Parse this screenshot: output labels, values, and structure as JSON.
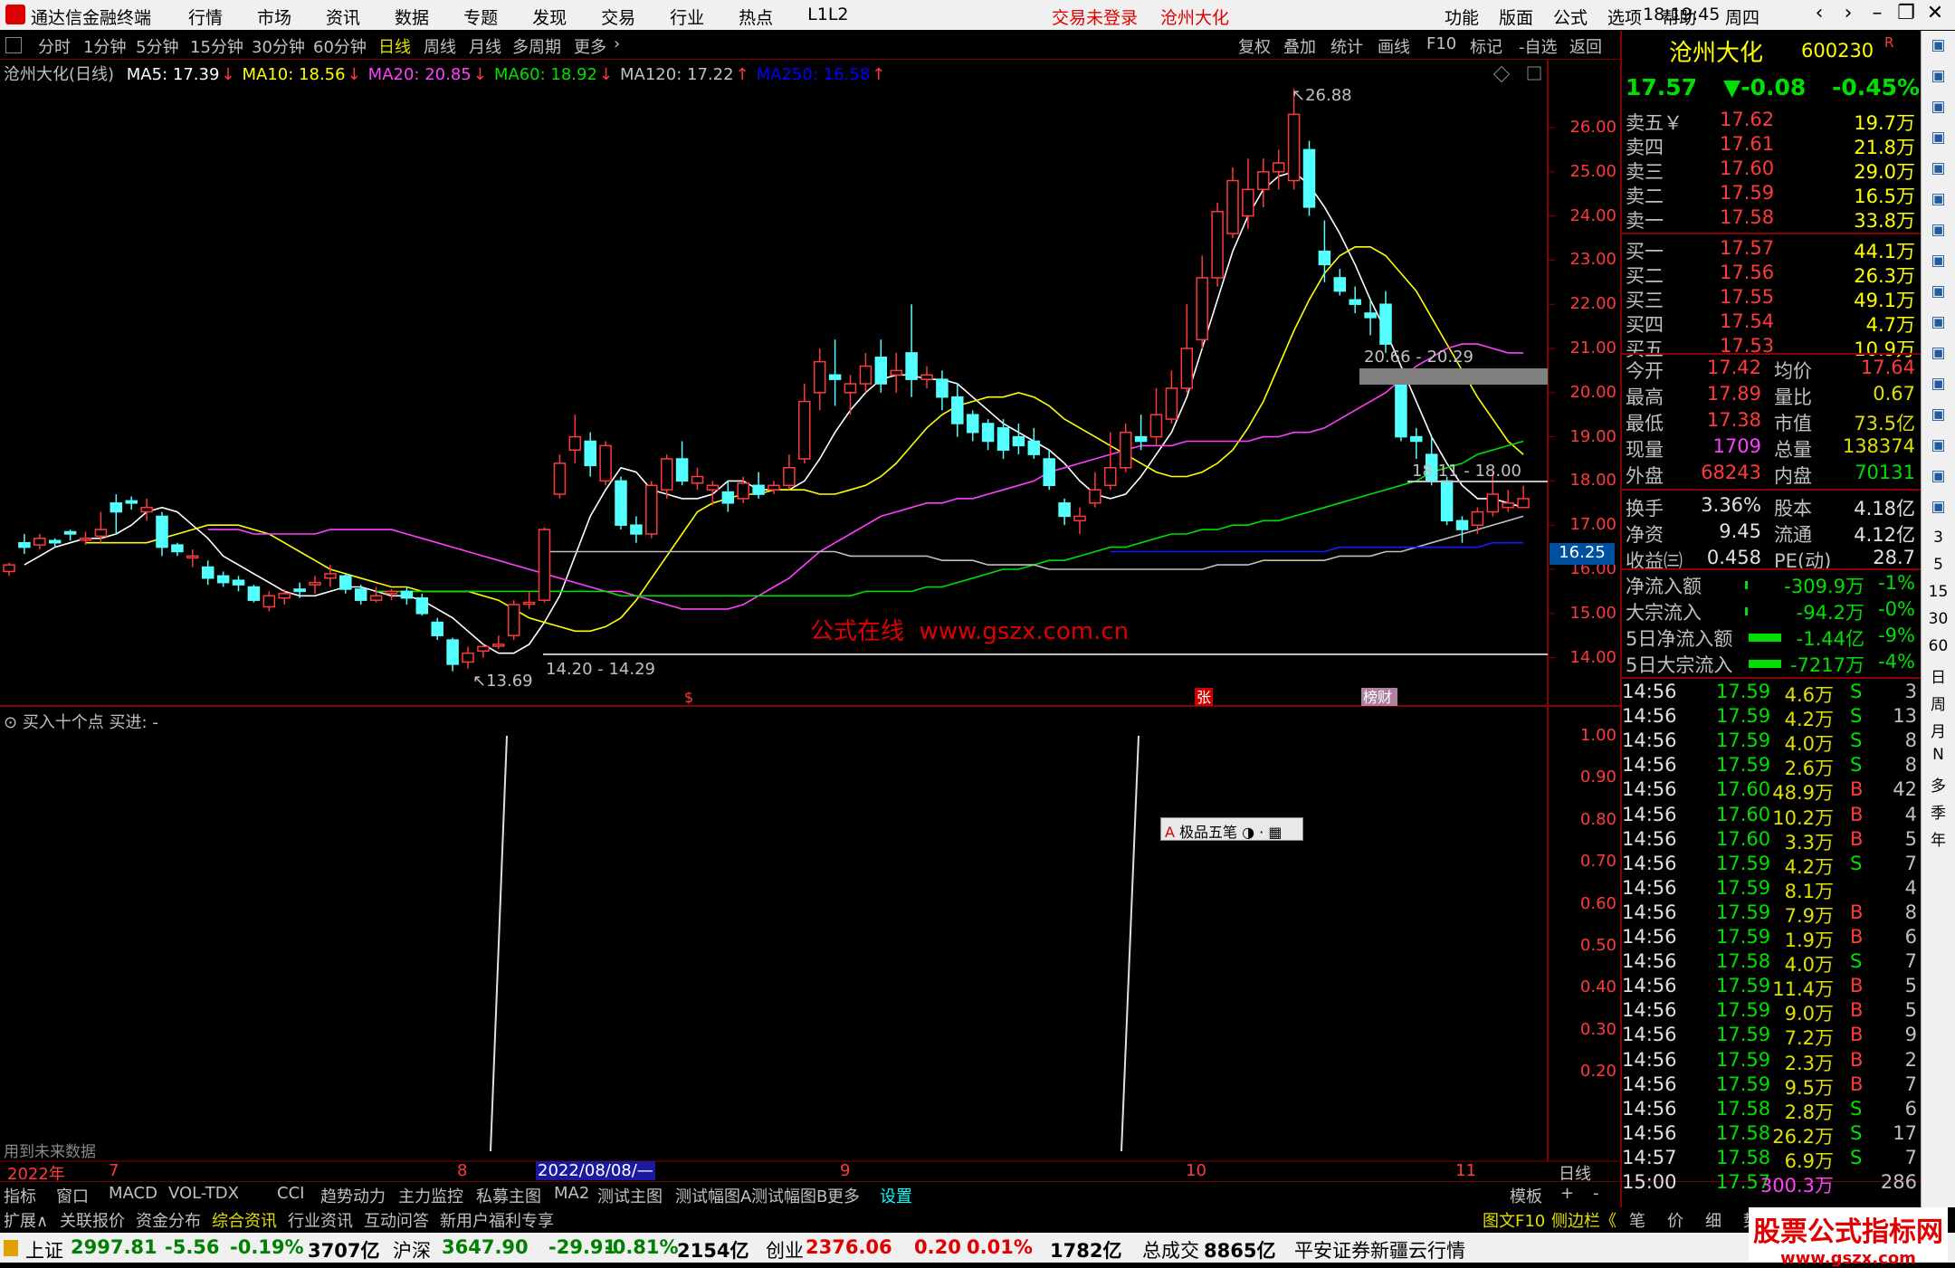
{
  "window": {
    "title": "通达信金融终端",
    "menu": [
      "行情",
      "市场",
      "资讯",
      "数据",
      "专题",
      "发现",
      "交易",
      "行业",
      "热点",
      "L1L2"
    ],
    "center_red": [
      "交易未登录",
      "沧州大化"
    ],
    "right_menu": [
      "功能",
      "版面",
      "公式",
      "选项",
      "帮助"
    ],
    "time": "18:19:45",
    "weekday": "周四"
  },
  "periods": [
    "分时",
    "1分钟",
    "5分钟",
    "15分钟",
    "30分钟",
    "60分钟",
    "日线",
    "周线",
    "月线",
    "多周期",
    "更多"
  ],
  "tools": [
    "复权",
    "叠加",
    "统计",
    "画线",
    "F10",
    "标记",
    "-自选",
    "返回"
  ],
  "main": {
    "name": "沧州大化(日线)",
    "ma": [
      {
        "label": "MA5: 17.39",
        "color": "#ffffff"
      },
      {
        "label": "MA10: 18.56",
        "color": "#ffff00"
      },
      {
        "label": "MA20: 20.85",
        "color": "#ff40ff"
      },
      {
        "label": "MA60: 18.92",
        "color": "#00e000"
      },
      {
        "label": "MA120: 17.22",
        "color": "#c0c0c0"
      },
      {
        "label": "MA250: 16.58",
        "color": "#0000ff"
      }
    ],
    "price_ticks": [
      "26.00",
      "25.00",
      "24.00",
      "23.00",
      "22.00",
      "21.00",
      "20.00",
      "19.00",
      "18.00",
      "17.00",
      "16.00",
      "15.00",
      "14.00"
    ],
    "current_price_tag": "16.25",
    "annotations": {
      "high": "26.88",
      "low": "13.69",
      "range1": "14.20 - 14.29",
      "range2": "20.66 - 20.29",
      "range3": "18.11 - 18.00"
    },
    "watermark": "公式在线  www.gszx.com.cn",
    "event_marks": [
      "$",
      "张",
      "榜财"
    ]
  },
  "indicator": {
    "title": "买入十个点  买进: -",
    "ticks": [
      "1.00",
      "0.90",
      "0.80",
      "0.70",
      "0.60",
      "0.50",
      "0.40",
      "0.30",
      "0.20"
    ],
    "footer": "用到未来数据",
    "popup": "极品五笔"
  },
  "xaxis": {
    "labels": [
      "2022年",
      "7",
      "8",
      "2022/08/08/—",
      "9",
      "10",
      "11"
    ],
    "right": "日线"
  },
  "bottom_tabs": [
    "指标",
    "窗口",
    "MACD",
    "VOL-TDX",
    "CCI",
    "趋势动力",
    "主力监控",
    "私募主图",
    "MA2",
    "测试主图",
    "测试幅图A",
    "测试幅图B",
    "更多",
    "设置"
  ],
  "bottom_tabs_right": [
    "模板",
    "+",
    "-"
  ],
  "bottom_row2": [
    "扩展∧",
    "关联报价",
    "资金分布",
    "综合资讯",
    "行业资讯",
    "互动问答",
    "新用户福利专享"
  ],
  "bottom_row2_right": [
    "图文F10",
    "侧边栏《",
    "笔",
    "价",
    "细",
    "势"
  ],
  "quote": {
    "name": "沧州大化",
    "code": "600230",
    "mark": "R",
    "price": "17.57",
    "change": "▼-0.08",
    "pct": "-0.45%",
    "sell": [
      [
        "卖五￥",
        "17.62",
        "19.7万"
      ],
      [
        "卖四",
        "17.61",
        "21.8万"
      ],
      [
        "卖三",
        "17.60",
        "29.0万"
      ],
      [
        "卖二",
        "17.59",
        "16.5万"
      ],
      [
        "卖一",
        "17.58",
        "33.8万"
      ]
    ],
    "buy": [
      [
        "买一",
        "17.57",
        "44.1万"
      ],
      [
        "买二",
        "17.56",
        "26.3万"
      ],
      [
        "买三",
        "17.55",
        "49.1万"
      ],
      [
        "买四",
        "17.54",
        "4.7万"
      ],
      [
        "买五",
        "17.53",
        "10.9万"
      ]
    ],
    "stats": [
      [
        "今开",
        "17.42",
        "均价",
        "17.64"
      ],
      [
        "最高",
        "17.89",
        "量比",
        "0.67"
      ],
      [
        "最低",
        "17.38",
        "市值",
        "73.5亿"
      ],
      [
        "现量",
        "1709",
        "总量",
        "138374"
      ],
      [
        "外盘",
        "68243",
        "内盘",
        "70131"
      ]
    ],
    "stats2": [
      [
        "换手",
        "3.36%",
        "股本",
        "4.18亿"
      ],
      [
        "净资",
        "9.45",
        "流通",
        "4.12亿"
      ],
      [
        "收益㈢",
        "0.458",
        "PE(动)",
        "28.7"
      ]
    ],
    "flows": [
      [
        "净流入额",
        "-309.9万",
        "-1%"
      ],
      [
        "大宗流入",
        "-94.2万",
        "-0%"
      ],
      [
        "5日净流入额",
        "-1.44亿",
        "-9%"
      ],
      [
        "5日大宗流入",
        "-7217万",
        "-4%"
      ]
    ],
    "ticks": [
      [
        "14:56",
        "17.59",
        "4.6万",
        "S",
        "3"
      ],
      [
        "14:56",
        "17.59",
        "4.2万",
        "S",
        "13"
      ],
      [
        "14:56",
        "17.59",
        "4.0万",
        "S",
        "8"
      ],
      [
        "14:56",
        "17.59",
        "2.6万",
        "S",
        "8"
      ],
      [
        "14:56",
        "17.60",
        "48.9万",
        "B",
        "42"
      ],
      [
        "14:56",
        "17.60",
        "10.2万",
        "B",
        "4"
      ],
      [
        "14:56",
        "17.60",
        "3.3万",
        "B",
        "5"
      ],
      [
        "14:56",
        "17.59",
        "4.2万",
        "S",
        "7"
      ],
      [
        "14:56",
        "17.59",
        "8.1万",
        "",
        "4"
      ],
      [
        "14:56",
        "17.59",
        "7.9万",
        "B",
        "8"
      ],
      [
        "14:56",
        "17.59",
        "1.9万",
        "B",
        "6"
      ],
      [
        "14:56",
        "17.58",
        "4.0万",
        "S",
        "7"
      ],
      [
        "14:56",
        "17.59",
        "11.4万",
        "B",
        "5"
      ],
      [
        "14:56",
        "17.59",
        "9.0万",
        "B",
        "5"
      ],
      [
        "14:56",
        "17.59",
        "7.2万",
        "B",
        "9"
      ],
      [
        "14:56",
        "17.59",
        "2.3万",
        "B",
        "2"
      ],
      [
        "14:56",
        "17.59",
        "9.5万",
        "B",
        "7"
      ],
      [
        "14:56",
        "17.58",
        "2.8万",
        "S",
        "6"
      ],
      [
        "14:56",
        "17.58",
        "26.2万",
        "S",
        "17"
      ],
      [
        "14:57",
        "17.58",
        "6.9万",
        "S",
        "7"
      ],
      [
        "15:00",
        "17.57",
        "300.3万",
        "",
        "286"
      ]
    ]
  },
  "sidebar": [
    "日",
    "周",
    "月",
    "N",
    "多",
    "季",
    "年"
  ],
  "sidebar_nums": [
    "3",
    "5",
    "15",
    "30",
    "60"
  ],
  "status": [
    {
      "t": "上证",
      "c": "#000"
    },
    {
      "t": "2997.81",
      "c": "#008000"
    },
    {
      "t": "-5.56",
      "c": "#008000"
    },
    {
      "t": "-0.19%",
      "c": "#008000"
    },
    {
      "t": "3707亿",
      "c": "#000"
    },
    {
      "t": "沪深",
      "c": "#000"
    },
    {
      "t": "3647.90",
      "c": "#008000"
    },
    {
      "t": "-29.91",
      "c": "#008000"
    },
    {
      "t": "-0.81%",
      "c": "#008000"
    },
    {
      "t": "2154亿",
      "c": "#000"
    },
    {
      "t": "创业",
      "c": "#000"
    },
    {
      "t": "2376.06",
      "c": "#e00000"
    },
    {
      "t": "0.20",
      "c": "#e00000"
    },
    {
      "t": "0.01%",
      "c": "#e00000"
    },
    {
      "t": "1782亿",
      "c": "#000"
    },
    {
      "t": "总成交",
      "c": "#000"
    },
    {
      "t": "8865亿",
      "c": "#000"
    },
    {
      "t": "平安证券新疆云行情",
      "c": "#000"
    }
  ],
  "logo_wm": {
    "t1": "股票公式指标网",
    "t2": "www.gszx.com"
  },
  "candles": [
    [
      15.95,
      16.1,
      15.85,
      16.15
    ],
    [
      16.6,
      16.5,
      16.35,
      16.8
    ],
    [
      16.55,
      16.7,
      16.45,
      16.8
    ],
    [
      16.65,
      16.6,
      16.5,
      16.7
    ],
    [
      16.85,
      16.8,
      16.65,
      16.9
    ],
    [
      16.7,
      16.7,
      16.55,
      16.85
    ],
    [
      16.75,
      16.9,
      16.6,
      17.3
    ],
    [
      17.5,
      17.3,
      16.8,
      17.7
    ],
    [
      17.55,
      17.5,
      17.35,
      17.65
    ],
    [
      17.3,
      17.4,
      17.1,
      17.6
    ],
    [
      17.2,
      16.5,
      16.3,
      17.3
    ],
    [
      16.55,
      16.4,
      16.3,
      16.6
    ],
    [
      16.3,
      16.3,
      16.05,
      16.45
    ],
    [
      16.05,
      15.8,
      15.65,
      16.2
    ],
    [
      15.85,
      15.7,
      15.6,
      15.95
    ],
    [
      15.75,
      15.65,
      15.5,
      15.85
    ],
    [
      15.6,
      15.3,
      15.25,
      15.65
    ],
    [
      15.15,
      15.4,
      15.05,
      15.5
    ],
    [
      15.35,
      15.45,
      15.2,
      15.55
    ],
    [
      15.55,
      15.5,
      15.35,
      15.7
    ],
    [
      15.65,
      15.7,
      15.45,
      15.85
    ],
    [
      15.8,
      15.9,
      15.6,
      16.1
    ],
    [
      15.85,
      15.55,
      15.45,
      15.9
    ],
    [
      15.55,
      15.3,
      15.2,
      15.65
    ],
    [
      15.3,
      15.4,
      15.25,
      15.6
    ],
    [
      15.45,
      15.5,
      15.3,
      15.55
    ],
    [
      15.5,
      15.35,
      15.2,
      15.6
    ],
    [
      15.35,
      15.0,
      14.95,
      15.45
    ],
    [
      14.8,
      14.5,
      14.4,
      14.9
    ],
    [
      14.4,
      13.85,
      13.69,
      14.45
    ],
    [
      13.9,
      14.1,
      13.75,
      14.25
    ],
    [
      14.15,
      14.25,
      14.0,
      14.3
    ],
    [
      14.3,
      14.3,
      14.2,
      14.5
    ],
    [
      14.5,
      15.2,
      14.4,
      15.3
    ],
    [
      15.25,
      15.25,
      15.1,
      15.5
    ],
    [
      15.3,
      16.9,
      15.25,
      16.95
    ],
    [
      17.7,
      18.4,
      17.6,
      18.6
    ],
    [
      18.7,
      19.0,
      18.4,
      19.5
    ],
    [
      18.9,
      18.35,
      18.1,
      19.1
    ],
    [
      18.0,
      18.8,
      17.9,
      18.9
    ],
    [
      18.0,
      17.0,
      16.9,
      18.1
    ],
    [
      17.0,
      16.8,
      16.6,
      17.2
    ],
    [
      16.8,
      17.9,
      16.7,
      18.0
    ],
    [
      17.8,
      18.5,
      17.6,
      18.6
    ],
    [
      18.5,
      18.0,
      17.9,
      18.9
    ],
    [
      17.95,
      18.1,
      17.8,
      18.3
    ],
    [
      17.8,
      17.9,
      17.45,
      18.0
    ],
    [
      17.75,
      17.5,
      17.3,
      18.0
    ],
    [
      17.6,
      17.95,
      17.5,
      18.1
    ],
    [
      17.9,
      17.7,
      17.6,
      18.2
    ],
    [
      17.8,
      17.9,
      17.7,
      18.0
    ],
    [
      17.9,
      18.3,
      17.8,
      18.6
    ],
    [
      18.5,
      19.8,
      18.4,
      20.2
    ],
    [
      20.0,
      20.7,
      19.6,
      21.0
    ],
    [
      20.4,
      20.3,
      19.7,
      21.2
    ],
    [
      20.0,
      20.2,
      19.5,
      20.4
    ],
    [
      20.2,
      20.6,
      20.0,
      20.9
    ],
    [
      20.8,
      20.2,
      20.0,
      21.2
    ],
    [
      20.4,
      20.5,
      20.0,
      20.9
    ],
    [
      20.9,
      20.3,
      19.9,
      22.0
    ],
    [
      20.3,
      20.4,
      20.1,
      20.6
    ],
    [
      20.3,
      19.9,
      19.6,
      20.5
    ],
    [
      19.9,
      19.3,
      19.0,
      20.2
    ],
    [
      19.5,
      19.1,
      18.9,
      19.6
    ],
    [
      19.3,
      18.9,
      18.7,
      19.4
    ],
    [
      19.2,
      18.7,
      18.5,
      19.4
    ],
    [
      19.0,
      18.8,
      18.6,
      19.3
    ],
    [
      18.9,
      18.6,
      18.5,
      19.2
    ],
    [
      18.5,
      17.9,
      17.8,
      18.7
    ],
    [
      17.5,
      17.2,
      17.0,
      17.6
    ],
    [
      17.1,
      17.2,
      16.8,
      17.4
    ],
    [
      17.5,
      17.8,
      17.4,
      18.2
    ],
    [
      17.9,
      18.3,
      17.8,
      19.1
    ],
    [
      18.3,
      19.1,
      18.2,
      19.3
    ],
    [
      19.0,
      18.9,
      18.7,
      19.5
    ],
    [
      19.0,
      19.5,
      18.8,
      20.1
    ],
    [
      19.4,
      20.1,
      19.3,
      20.5
    ],
    [
      20.1,
      21.0,
      20.0,
      22.0
    ],
    [
      21.2,
      22.6,
      21.0,
      23.1
    ],
    [
      22.6,
      24.1,
      22.4,
      24.3
    ],
    [
      23.6,
      24.8,
      23.5,
      25.1
    ],
    [
      24.0,
      24.6,
      23.7,
      25.3
    ],
    [
      24.6,
      25.0,
      24.2,
      25.3
    ],
    [
      25.0,
      25.2,
      24.6,
      25.5
    ],
    [
      24.8,
      26.3,
      24.6,
      26.88
    ],
    [
      25.5,
      24.2,
      24.0,
      25.7
    ],
    [
      23.2,
      22.9,
      22.5,
      23.9
    ],
    [
      22.6,
      22.3,
      22.2,
      22.8
    ],
    [
      22.1,
      22.0,
      21.8,
      22.4
    ],
    [
      21.8,
      21.7,
      21.3,
      22.1
    ],
    [
      22.0,
      21.1,
      20.9,
      22.3
    ],
    [
      20.3,
      19.0,
      18.9,
      20.4
    ],
    [
      19.0,
      18.9,
      18.5,
      19.2
    ],
    [
      18.6,
      18.0,
      17.9,
      19.0
    ],
    [
      18.0,
      17.1,
      17.0,
      18.1
    ],
    [
      17.1,
      16.9,
      16.6,
      17.2
    ],
    [
      17.0,
      17.3,
      16.8,
      17.4
    ],
    [
      17.3,
      17.7,
      17.2,
      18.2
    ],
    [
      17.4,
      17.5,
      17.3,
      17.8
    ],
    [
      17.4,
      17.6,
      17.38,
      17.89
    ]
  ],
  "ma_lines": {
    "ma5": [
      16.1,
      16.3,
      16.5,
      16.6,
      16.7,
      16.7,
      16.8,
      17.0,
      17.3,
      17.4,
      17.3,
      17.0,
      16.7,
      16.3,
      16.1,
      15.9,
      15.7,
      15.5,
      15.4,
      15.4,
      15.5,
      15.6,
      15.6,
      15.5,
      15.4,
      15.4,
      15.3,
      15.1,
      14.9,
      14.6,
      14.3,
      14.1,
      14.1,
      14.3,
      14.8,
      15.4,
      16.3,
      17.2,
      17.8,
      18.3,
      18.2,
      17.8,
      17.7,
      17.6,
      17.6,
      17.7,
      18.0,
      18.0,
      17.8,
      17.8,
      17.8,
      18.0,
      18.5,
      19.1,
      19.6,
      20.0,
      20.3,
      20.4,
      20.4,
      20.3,
      20.3,
      20.2,
      19.9,
      19.6,
      19.3,
      19.1,
      18.9,
      18.7,
      18.4,
      18.0,
      17.7,
      17.6,
      17.7,
      18.1,
      18.6,
      19.1,
      19.9,
      21.0,
      22.1,
      23.2,
      24.0,
      24.6,
      24.9,
      25.0,
      24.7,
      24.2,
      23.6,
      22.9,
      22.1,
      21.4,
      20.6,
      19.8,
      19.0,
      18.4,
      17.9,
      17.6,
      17.6,
      17.5,
      17.4
    ],
    "ma10": [
      16.6,
      16.6,
      16.6,
      16.6,
      16.6,
      16.7,
      16.8,
      16.9,
      17.0,
      17.0,
      17.0,
      16.9,
      16.8,
      16.6,
      16.4,
      16.2,
      16.0,
      15.9,
      15.8,
      15.7,
      15.6,
      15.6,
      15.5,
      15.5,
      15.5,
      15.5,
      15.4,
      15.3,
      15.1,
      14.9,
      14.8,
      14.7,
      14.6,
      14.6,
      14.7,
      14.9,
      15.3,
      15.8,
      16.3,
      16.8,
      17.3,
      17.5,
      17.6,
      17.7,
      17.7,
      17.8,
      17.8,
      17.8,
      17.7,
      17.7,
      17.8,
      17.9,
      18.1,
      18.4,
      18.8,
      19.2,
      19.5,
      19.7,
      19.8,
      19.9,
      19.9,
      20.0,
      19.9,
      19.7,
      19.4,
      19.2,
      19.0,
      18.8,
      18.6,
      18.4,
      18.2,
      18.1,
      18.1,
      18.2,
      18.4,
      18.7,
      19.2,
      19.8,
      20.6,
      21.4,
      22.1,
      22.7,
      23.1,
      23.3,
      23.3,
      23.1,
      22.7,
      22.3,
      21.7,
      21.1,
      20.5,
      19.9,
      19.4,
      18.9,
      18.6
    ],
    "ma20": [
      16.9,
      16.9,
      16.9,
      16.8,
      16.8,
      16.8,
      16.8,
      16.8,
      16.9,
      16.9,
      16.9,
      16.9,
      16.9,
      16.8,
      16.7,
      16.6,
      16.5,
      16.4,
      16.3,
      16.2,
      16.1,
      16.0,
      15.9,
      15.8,
      15.7,
      15.6,
      15.5,
      15.5,
      15.4,
      15.3,
      15.2,
      15.1,
      15.1,
      15.1,
      15.1,
      15.2,
      15.4,
      15.6,
      15.8,
      16.1,
      16.4,
      16.6,
      16.8,
      17.0,
      17.2,
      17.3,
      17.4,
      17.5,
      17.5,
      17.6,
      17.6,
      17.7,
      17.8,
      17.9,
      18.0,
      18.2,
      18.3,
      18.4,
      18.5,
      18.6,
      18.7,
      18.8,
      18.8,
      18.8,
      18.9,
      18.9,
      18.9,
      18.9,
      18.9,
      19.0,
      19.0,
      19.1,
      19.1,
      19.2,
      19.4,
      19.6,
      19.8,
      20.0,
      20.3,
      20.6,
      20.8,
      21.0,
      21.1,
      21.1,
      21.0,
      20.9,
      20.9
    ],
    "ma60": [
      15.5,
      15.5,
      15.5,
      15.5,
      15.5,
      15.5,
      15.5,
      15.5,
      15.5,
      15.5,
      15.5,
      15.5,
      15.5,
      15.5,
      15.5,
      15.5,
      15.4,
      15.4,
      15.4,
      15.4,
      15.4,
      15.4,
      15.4,
      15.4,
      15.4,
      15.4,
      15.4,
      15.4,
      15.4,
      15.4,
      15.4,
      15.4,
      15.5,
      15.5,
      15.5,
      15.5,
      15.6,
      15.6,
      15.7,
      15.8,
      15.9,
      16.0,
      16.0,
      16.1,
      16.2,
      16.2,
      16.3,
      16.4,
      16.5,
      16.5,
      16.6,
      16.7,
      16.8,
      16.8,
      16.9,
      16.9,
      17.0,
      17.0,
      17.1,
      17.1,
      17.2,
      17.3,
      17.4,
      17.5,
      17.6,
      17.7,
      17.8,
      17.9,
      18.0,
      18.2,
      18.3,
      18.4,
      18.6,
      18.7,
      18.8,
      18.9
    ],
    "ma120": [
      16.4,
      16.4,
      16.4,
      16.4,
      16.4,
      16.4,
      16.4,
      16.4,
      16.4,
      16.4,
      16.4,
      16.4,
      16.4,
      16.4,
      16.4,
      16.4,
      16.4,
      16.4,
      16.4,
      16.4,
      16.3,
      16.3,
      16.3,
      16.3,
      16.3,
      16.3,
      16.2,
      16.2,
      16.2,
      16.1,
      16.1,
      16.1,
      16.1,
      16.0,
      16.0,
      16.0,
      16.0,
      16.0,
      16.0,
      16.0,
      16.0,
      16.0,
      16.0,
      16.0,
      16.1,
      16.1,
      16.1,
      16.2,
      16.2,
      16.2,
      16.2,
      16.2,
      16.3,
      16.3,
      16.3,
      16.4,
      16.4,
      16.5,
      16.6,
      16.7,
      16.8,
      16.9,
      17.0,
      17.1,
      17.2
    ],
    "ma250": [
      16.4,
      16.4,
      16.4,
      16.4,
      16.4,
      16.4,
      16.4,
      16.4,
      16.4,
      16.4,
      16.4,
      16.4,
      16.4,
      16.4,
      16.4,
      16.5,
      16.5,
      16.5,
      16.5,
      16.5,
      16.5,
      16.5,
      16.5,
      16.5,
      16.5,
      16.6,
      16.6,
      16.6
    ]
  }
}
